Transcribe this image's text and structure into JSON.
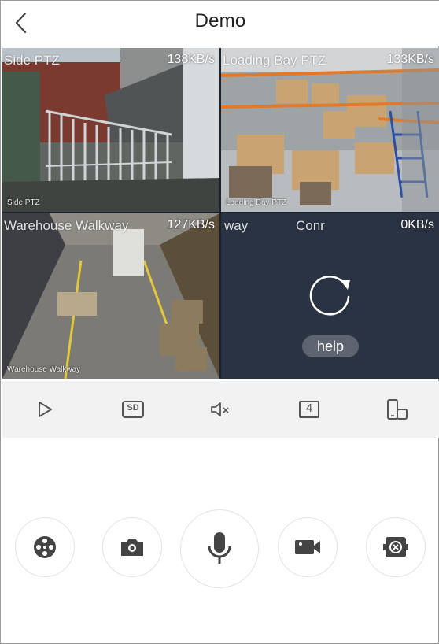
{
  "header": {
    "title": "Demo",
    "back_icon": "chevron-left-icon"
  },
  "cameras": [
    {
      "name": "Side PTZ",
      "speed": "138KB/s",
      "osd": "Side PTZ"
    },
    {
      "name": "Loading Bay PTZ",
      "speed": "133KB/s",
      "osd": "Loading Bay PTZ"
    },
    {
      "name": "Warehouse Walkway",
      "speed": "127KB/s",
      "osd": "Warehouse Walkway"
    },
    {
      "name": "way",
      "name2": "Conr",
      "speed": "0KB/s",
      "state": "reconnect",
      "help_label": "help"
    }
  ],
  "toolbar": {
    "items": [
      "play-icon",
      "sd-quality-icon",
      "mute-icon",
      "split-4-icon",
      "rotate-screen-icon"
    ],
    "sd_label": "SD",
    "split_label": "4"
  },
  "actions": {
    "items": [
      "ptz-control-icon",
      "snapshot-icon",
      "microphone-icon",
      "record-icon",
      "close-all-icon"
    ]
  },
  "colors": {
    "accent": "#3d8fe0",
    "icon_gray": "#555555",
    "toolbar_bg": "#f2f2f2",
    "offline_tile": "#2a3343"
  }
}
